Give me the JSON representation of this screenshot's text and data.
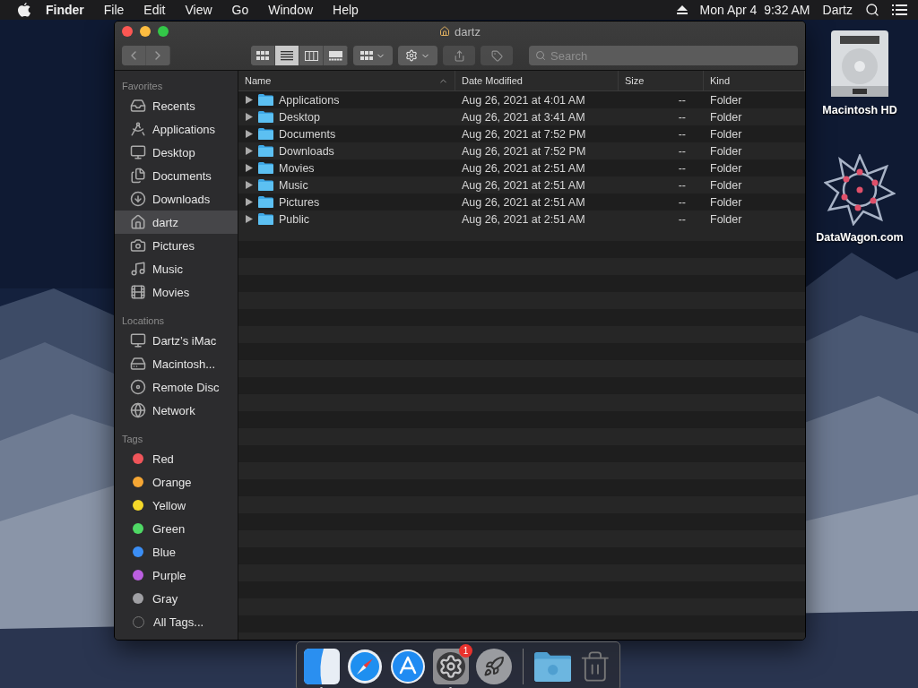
{
  "menu_bar": {
    "menus": [
      {
        "label": "Finder",
        "bold": true
      },
      {
        "label": "File",
        "bold": false
      },
      {
        "label": "Edit",
        "bold": false
      },
      {
        "label": "View",
        "bold": false
      },
      {
        "label": "Go",
        "bold": false
      },
      {
        "label": "Window",
        "bold": false
      },
      {
        "label": "Help",
        "bold": false
      }
    ],
    "clock": "Mon Apr 4  9:32 AM",
    "user": "Dartz"
  },
  "window": {
    "title": "dartz",
    "view_modes": [
      {
        "kind": "icons",
        "selected": false
      },
      {
        "kind": "list",
        "selected": true
      },
      {
        "kind": "columns",
        "selected": false
      },
      {
        "kind": "gallery",
        "selected": false
      }
    ],
    "search": {
      "placeholder": "Search"
    }
  },
  "sidebar": {
    "sections": [
      {
        "title": "Favorites",
        "items": [
          {
            "kind": "place",
            "label": "Recents",
            "selected": false
          },
          {
            "kind": "place",
            "label": "Applications",
            "selected": false
          },
          {
            "kind": "place",
            "label": "Desktop",
            "selected": false
          },
          {
            "kind": "place",
            "label": "Documents",
            "selected": false
          },
          {
            "kind": "place",
            "label": "Downloads",
            "selected": false
          },
          {
            "kind": "place",
            "label": "dartz",
            "selected": true
          },
          {
            "kind": "place",
            "label": "Pictures",
            "selected": false
          },
          {
            "kind": "place",
            "label": "Music",
            "selected": false
          },
          {
            "kind": "place",
            "label": "Movies",
            "selected": false
          }
        ]
      },
      {
        "title": "Locations",
        "items": [
          {
            "kind": "place",
            "label": "Dartz’s iMac",
            "selected": false
          },
          {
            "kind": "place",
            "label": "Macintosh...",
            "selected": false
          },
          {
            "kind": "place",
            "label": "Remote Disc",
            "selected": false
          },
          {
            "kind": "place",
            "label": "Network",
            "selected": false
          }
        ]
      },
      {
        "title": "Tags",
        "items": [
          {
            "kind": "tag",
            "label": "Red",
            "color": "#f0555a",
            "selected": false
          },
          {
            "kind": "tag",
            "label": "Orange",
            "color": "#f5a634",
            "selected": false
          },
          {
            "kind": "tag",
            "label": "Yellow",
            "color": "#f5d829",
            "selected": false
          },
          {
            "kind": "tag",
            "label": "Green",
            "color": "#4fd865",
            "selected": false
          },
          {
            "kind": "tag",
            "label": "Blue",
            "color": "#3b8ef5",
            "selected": false
          },
          {
            "kind": "tag",
            "label": "Purple",
            "color": "#bb5fe0",
            "selected": false
          },
          {
            "kind": "tag",
            "label": "Gray",
            "color": "#a0a0a4",
            "selected": false
          },
          {
            "kind": "all-tags",
            "label": "All Tags...",
            "selected": false
          }
        ]
      }
    ]
  },
  "table": {
    "columns": [
      {
        "label": "Name",
        "sorted": true
      },
      {
        "label": "Date Modified",
        "sorted": false
      },
      {
        "label": "Size",
        "sorted": false
      },
      {
        "label": "Kind",
        "sorted": false
      }
    ],
    "rows": [
      {
        "name": "Applications",
        "date": "Aug 26, 2021 at 4:01 AM",
        "size": "--",
        "kind": "Folder",
        "expanded": false
      },
      {
        "name": "Desktop",
        "date": "Aug 26, 2021 at 3:41 AM",
        "size": "--",
        "kind": "Folder",
        "expanded": false
      },
      {
        "name": "Documents",
        "date": "Aug 26, 2021 at 7:52 PM",
        "size": "--",
        "kind": "Folder",
        "expanded": false
      },
      {
        "name": "Downloads",
        "date": "Aug 26, 2021 at 7:52 PM",
        "size": "--",
        "kind": "Folder",
        "expanded": false
      },
      {
        "name": "Movies",
        "date": "Aug 26, 2021 at 2:51 AM",
        "size": "--",
        "kind": "Folder",
        "expanded": false
      },
      {
        "name": "Music",
        "date": "Aug 26, 2021 at 2:51 AM",
        "size": "--",
        "kind": "Folder",
        "expanded": false
      },
      {
        "name": "Pictures",
        "date": "Aug 26, 2021 at 2:51 AM",
        "size": "--",
        "kind": "Folder",
        "expanded": false
      },
      {
        "name": "Public",
        "date": "Aug 26, 2021 at 2:51 AM",
        "size": "--",
        "kind": "Folder",
        "expanded": false
      }
    ]
  },
  "desktop_icons": [
    {
      "label": "Macintosh HD"
    },
    {
      "label": "DataWagon.com"
    }
  ],
  "dock": {
    "apps": [
      {
        "running": true
      },
      {
        "running": false
      },
      {
        "running": false
      },
      {
        "running": true,
        "badge": "1"
      },
      {
        "running": false
      }
    ]
  }
}
